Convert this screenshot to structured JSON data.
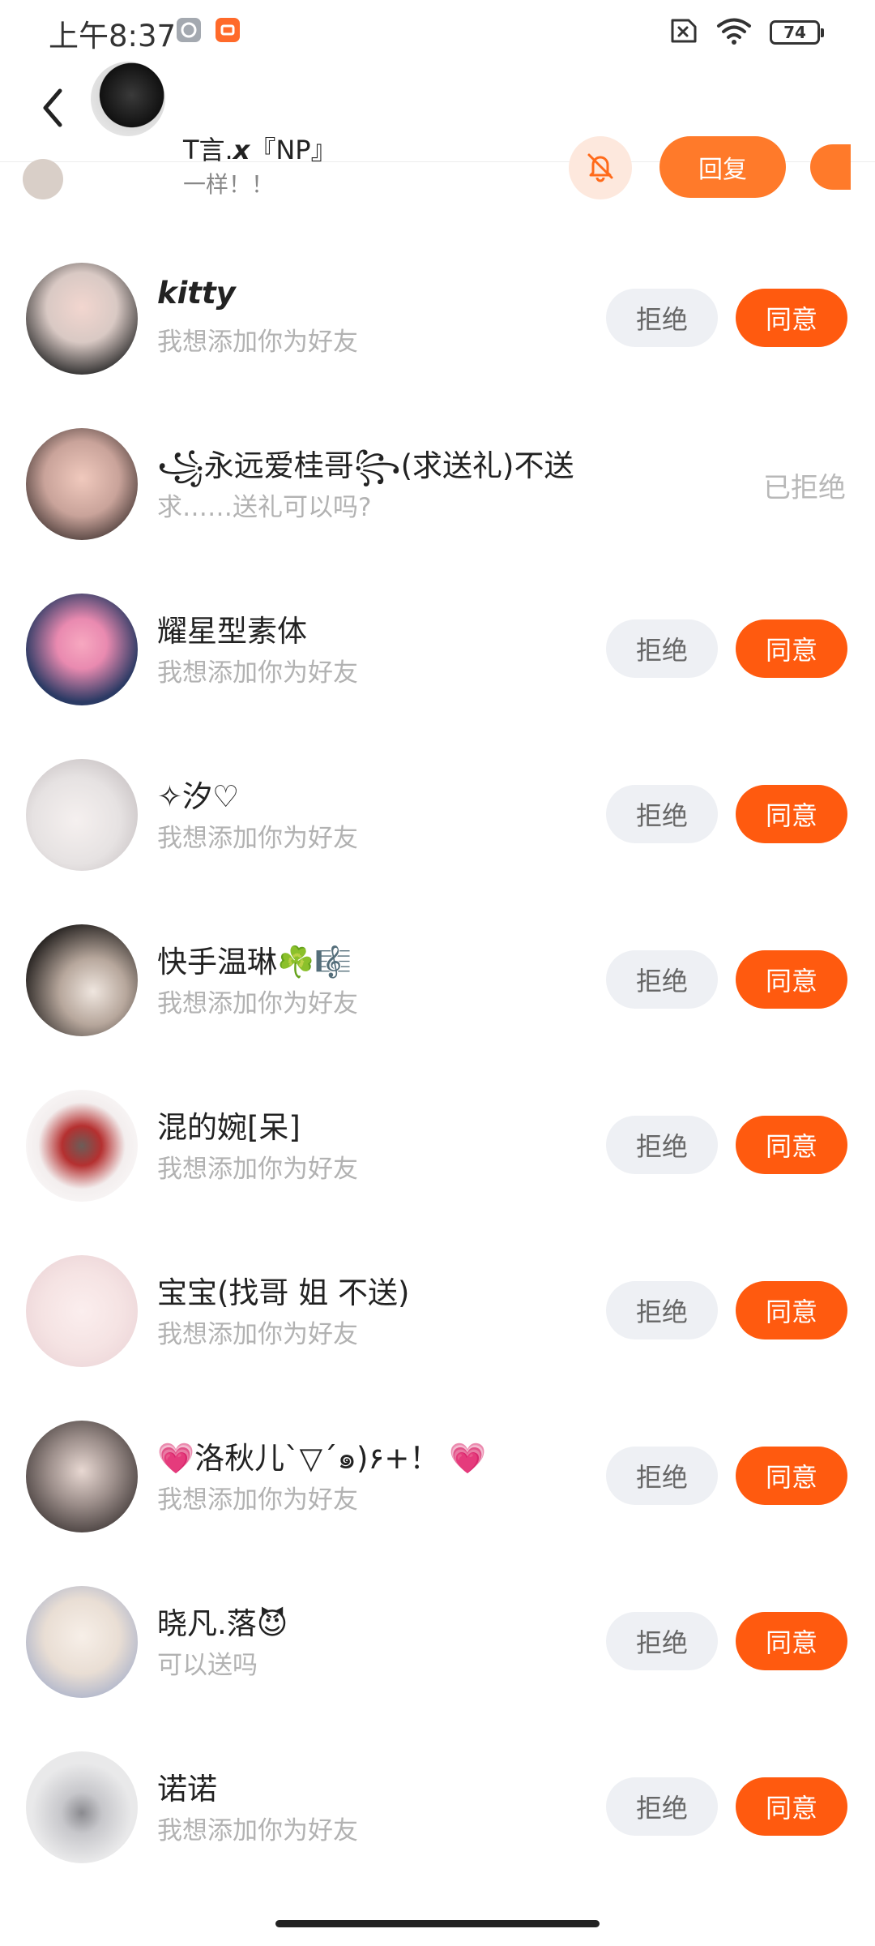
{
  "status_bar": {
    "time": "上午8:37",
    "battery": "74",
    "icons": [
      "gray-app-icon",
      "orange-app-icon",
      "sim-off-icon",
      "wifi-icon",
      "battery-icon"
    ]
  },
  "header": {
    "back_icon": "chevron-left-icon"
  },
  "banner": {
    "name": "T言.𝙭『NP』",
    "message": "一样！！",
    "mute_icon": "bell-off-icon",
    "reply_label": "回复"
  },
  "requests": [
    {
      "name": "kitty",
      "message": "我想添加你为好友",
      "decline_label": "拒绝",
      "accept_label": "同意",
      "avatar_color": "#d9c9c4"
    },
    {
      "name": "꧁永远爱桂哥꧂(求送礼)不送",
      "message": "求……送礼可以吗?",
      "status": "已拒绝",
      "avatar_color": "#c9a39a"
    },
    {
      "name": "耀星型素体",
      "message": "我想添加你为好友",
      "decline_label": "拒绝",
      "accept_label": "同意",
      "avatar_color": "#2b3a64"
    },
    {
      "name": "✧汐♡",
      "message": "我想添加你为好友",
      "decline_label": "拒绝",
      "accept_label": "同意",
      "avatar_color": "#e6e2e2"
    },
    {
      "name": "快手温琳☘️🎼",
      "message": "我想添加你为好友",
      "decline_label": "拒绝",
      "accept_label": "同意",
      "avatar_color": "#3c3634"
    },
    {
      "name": "混的婉[呆]",
      "message": "我想添加你为好友",
      "decline_label": "拒绝",
      "accept_label": "同意",
      "avatar_color": "#f3eeee"
    },
    {
      "name": "宝宝(找哥 姐 不送)",
      "message": "我想添加你为好友",
      "decline_label": "拒绝",
      "accept_label": "同意",
      "avatar_color": "#f5e3e3"
    },
    {
      "name": "💗洛秋儿`▽´๑)۶+！ 💗",
      "message": "我想添加你为好友",
      "decline_label": "拒绝",
      "accept_label": "同意",
      "avatar_color": "#6d6563"
    },
    {
      "name": "晓凡.落😈",
      "message": "可以送吗",
      "decline_label": "拒绝",
      "accept_label": "同意",
      "avatar_color": "#e9ded4"
    },
    {
      "name": "诺诺",
      "message": "我想添加你为好友",
      "decline_label": "拒绝",
      "accept_label": "同意",
      "avatar_color": "#e9e9ea"
    }
  ]
}
